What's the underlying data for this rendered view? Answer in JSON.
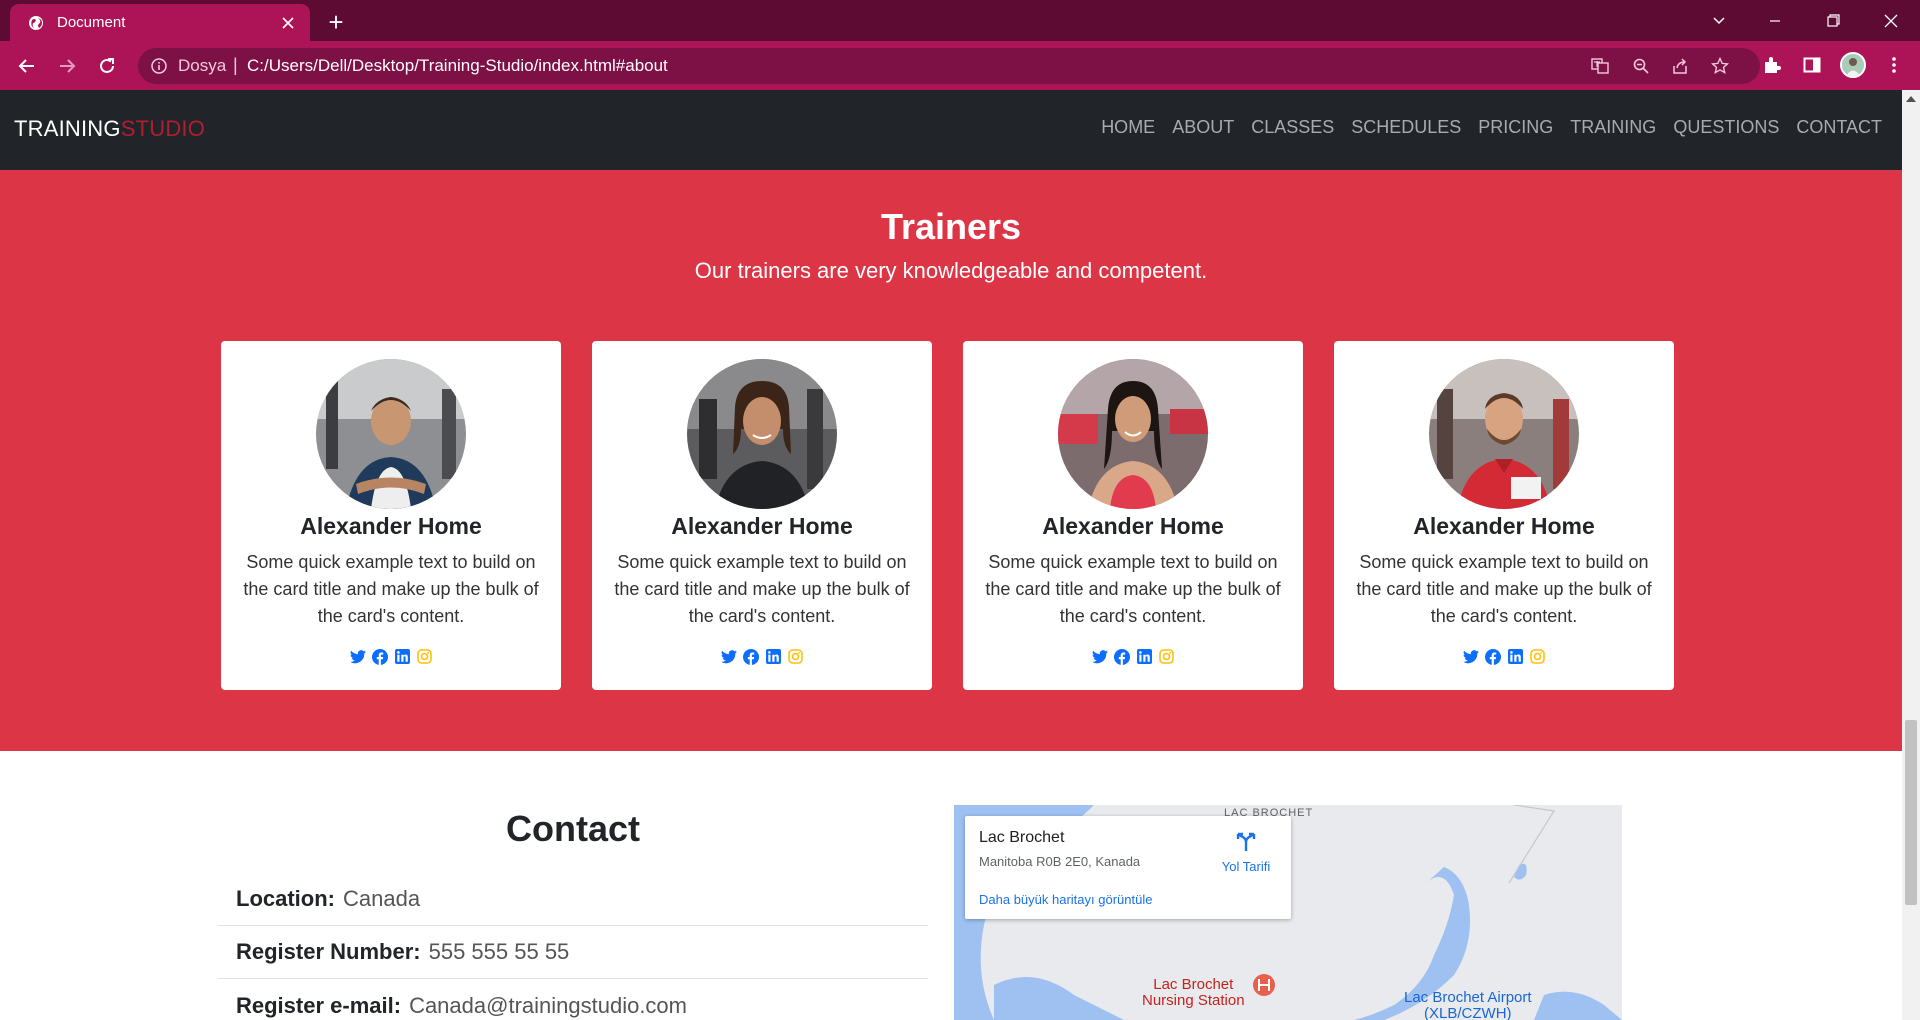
{
  "browser": {
    "tab_title": "Document",
    "new_tab_symbol": "+",
    "url_scheme": "Dosya",
    "url": "C:/Users/Dell/Desktop/Training-Studio/index.html#about"
  },
  "navbar": {
    "brand_part1": "TRAINING",
    "brand_part2": "STUDIO",
    "items": [
      "HOME",
      "ABOUT",
      "CLASSES",
      "SCHEDULES",
      "PRICING",
      "TRAINING",
      "QUESTIONS",
      "CONTACT"
    ]
  },
  "trainers": {
    "title": "Trainers",
    "subtitle": "Our trainers are very knowledgeable and competent.",
    "cards": [
      {
        "name": "Alexander Home",
        "text": "Some quick example text to build on the card title and make up the bulk of the card's content."
      },
      {
        "name": "Alexander Home",
        "text": "Some quick example text to build on the card title and make up the bulk of the card's content."
      },
      {
        "name": "Alexander Home",
        "text": "Some quick example text to build on the card title and make up the bulk of the card's content."
      },
      {
        "name": "Alexander Home",
        "text": "Some quick example text to build on the card title and make up the bulk of the card's content."
      }
    ],
    "social_icons": [
      "twitter-icon",
      "facebook-icon",
      "linkedin-icon",
      "instagram-icon"
    ]
  },
  "contact": {
    "title": "Contact",
    "rows": [
      {
        "label": "Location:",
        "value": "Canada"
      },
      {
        "label": "Register Number:",
        "value": "555 555 55 55"
      },
      {
        "label": "Register e-mail:",
        "value": "Canada@trainingstudio.com"
      }
    ]
  },
  "map": {
    "place_title": "Lac Brochet",
    "address": "Manitoba R0B 2E0, Kanada",
    "directions_label": "Yol Tarifi",
    "larger_map_link": "Daha büyük haritayı görüntüle",
    "label_top": "LAC BROCHET",
    "label_poi_line1": "Lac Brochet",
    "label_poi_line2": "Nursing Station",
    "label_airport_line1": "Lac Brochet Airport",
    "label_airport_line2": "(XLB/CZWH)"
  },
  "colors": {
    "chrome_dark": "#5e0b33",
    "chrome": "#ad1457",
    "navbar": "#212529",
    "accent_red": "#dc3545",
    "brand_red": "#b21e2f"
  }
}
